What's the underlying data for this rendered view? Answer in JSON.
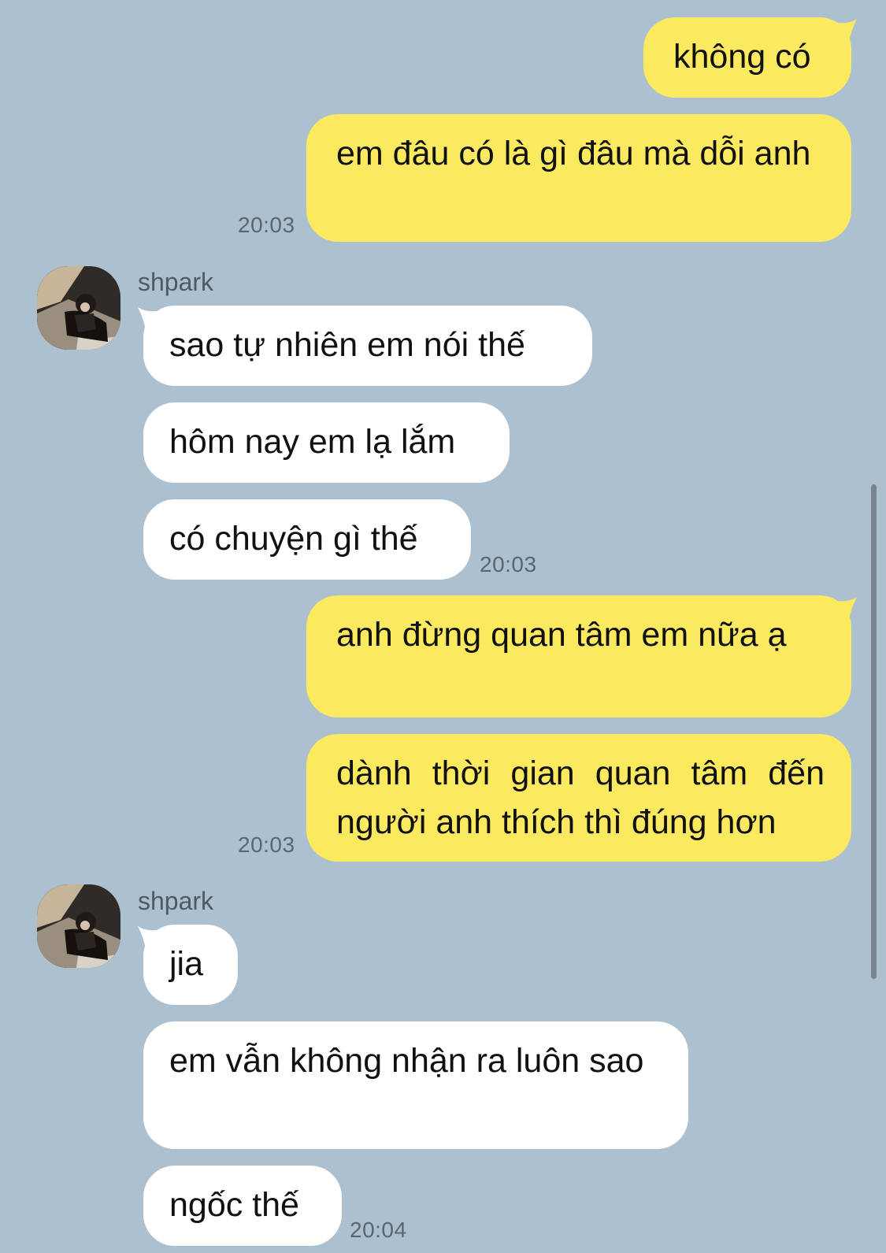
{
  "messages": [
    {
      "text": "không có"
    },
    {
      "text": "em đâu có là gì đâu mà dỗi anh"
    },
    {
      "text": "sao tự nhiên em nói thế"
    },
    {
      "text": "hôm nay em lạ lắm"
    },
    {
      "text": "có chuyện gì thế"
    },
    {
      "text": "anh đừng quan tâm em nữa ạ"
    },
    {
      "text": "dành thời gian quan tâm đến người anh thích thì đúng hơn"
    },
    {
      "text": "jia"
    },
    {
      "text": "em vẫn không nhận ra luôn sao"
    },
    {
      "text": "ngốc thế"
    }
  ],
  "timestamps": [
    "20:03",
    "20:03",
    "20:03",
    "20:04"
  ],
  "senders": [
    "shpark",
    "shpark"
  ],
  "colors": {
    "background": "#acc0d0",
    "outgoing_bubble": "#fbe960",
    "incoming_bubble": "#ffffff",
    "timestamp": "#5a6672"
  },
  "icons": [
    "avatar-photo"
  ]
}
